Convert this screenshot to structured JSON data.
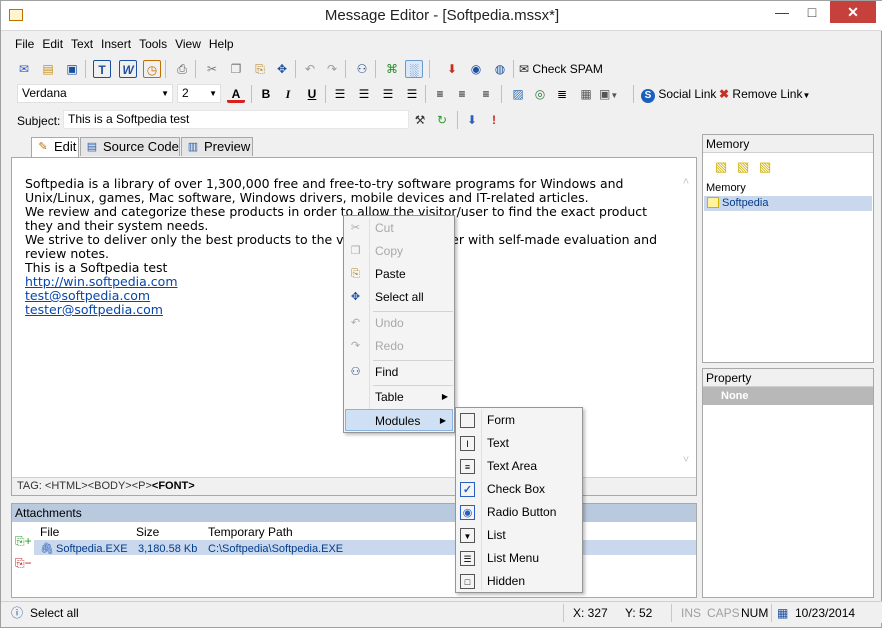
{
  "window": {
    "title": "Message Editor - [Softpedia.mssx*]"
  },
  "menu": [
    "File",
    "Edit",
    "Text",
    "Insert",
    "Tools",
    "View",
    "Help"
  ],
  "toolbar1": {
    "check_spam": "Check SPAM"
  },
  "toolbar2": {
    "font": "Verdana",
    "size": "2",
    "social_link": "Social Link",
    "remove_link": "Remove Link"
  },
  "subject": {
    "label": "Subject:",
    "value": "This is a Softpedia test"
  },
  "tabs": [
    "Edit",
    "Source Code",
    "Preview"
  ],
  "editor": {
    "lines": [
      "Softpedia is a library of over 1,300,000 free and free-to-try software programs for Windows and",
      "Unix/Linux, games, Mac software, Windows drivers, mobile devices and IT-related articles.",
      "We review and categorize these products in order to allow the visitor/user to find the exact product",
      "they and their system needs.",
      "We strive to deliver only the best products to the visitor/user together with self-made evaluation and",
      "review notes.",
      "This is a Softpedia test"
    ],
    "links": [
      "http://win.softpedia.com",
      "test@softpedia.com",
      "tester@softpedia.com"
    ],
    "tagbar_prefix": "TAG: <HTML><BODY><P>",
    "tagbar_current": "<FONT>"
  },
  "attachments": {
    "title": "Attachments",
    "columns": [
      "File",
      "Size",
      "Temporary Path"
    ],
    "rows": [
      {
        "file": "Softpedia.EXE",
        "size": "3,180.58 Kb",
        "path": "C:\\Softpedia\\Softpedia.EXE"
      }
    ]
  },
  "memory": {
    "title": "Memory",
    "section": "Memory",
    "items": [
      "Softpedia"
    ]
  },
  "property": {
    "title": "Property",
    "none": "None"
  },
  "context_menu": {
    "items": [
      {
        "label": "Cut",
        "disabled": true
      },
      {
        "label": "Copy",
        "disabled": true
      },
      {
        "label": "Paste",
        "disabled": false
      },
      {
        "label": "Select all",
        "disabled": false
      },
      {
        "label": "Undo",
        "disabled": true
      },
      {
        "label": "Redo",
        "disabled": true
      },
      {
        "label": "Find",
        "disabled": false
      },
      {
        "label": "Table",
        "disabled": false
      },
      {
        "label": "Modules",
        "disabled": false
      }
    ]
  },
  "modules_menu": [
    "Form",
    "Text",
    "Text Area",
    "Check Box",
    "Radio Button",
    "List",
    "List Menu",
    "Hidden"
  ],
  "status": {
    "text": "Select all",
    "x": "X: 327",
    "y": "Y: 52",
    "ins": "INS",
    "caps": "CAPS",
    "num": "NUM",
    "date": "10/23/2014"
  },
  "colors": {
    "attachments_header": "#b9c9de",
    "selection": "#cad8ee",
    "close_button": "#c7413c",
    "link": "#0645ad"
  }
}
